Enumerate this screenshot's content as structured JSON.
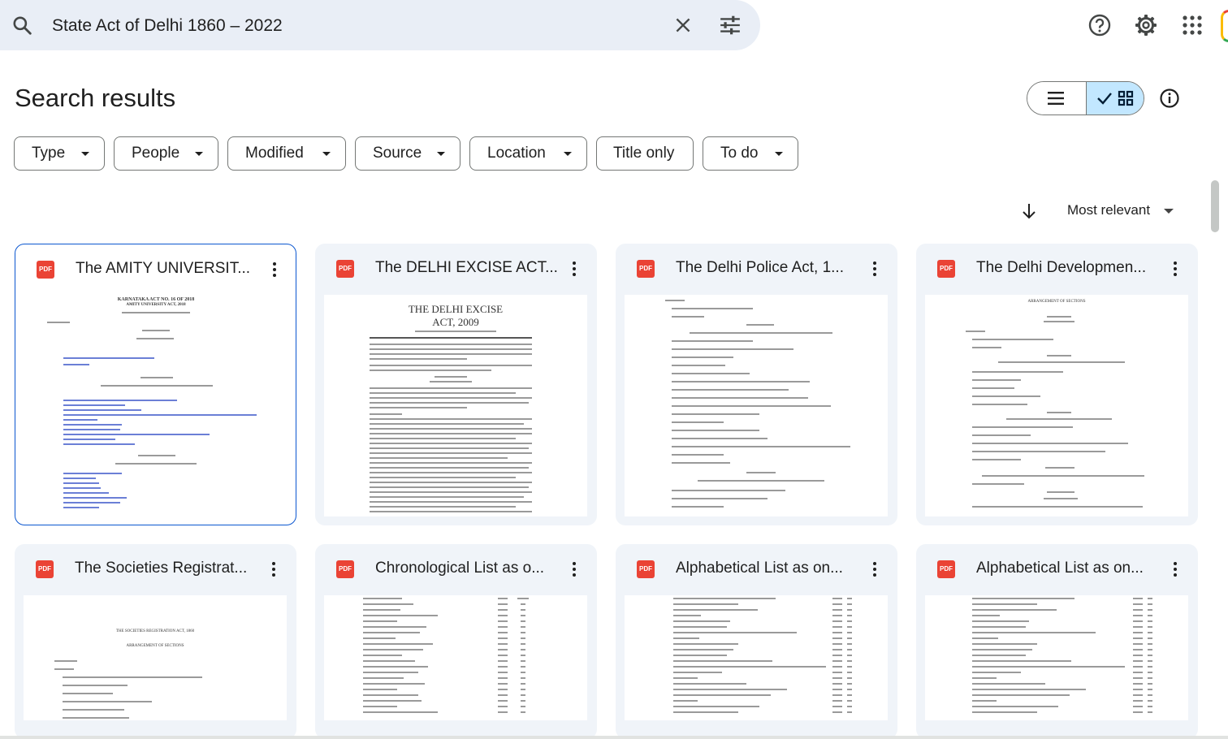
{
  "search": {
    "query": "State Act of Delhi 1860 – 2022"
  },
  "page": {
    "title": "Search results"
  },
  "filters": [
    {
      "label": "Type",
      "dropdown": true
    },
    {
      "label": "People",
      "dropdown": true
    },
    {
      "label": "Modified",
      "dropdown": true
    },
    {
      "label": "Source",
      "dropdown": true
    },
    {
      "label": "Location",
      "dropdown": true
    },
    {
      "label": "Title only",
      "dropdown": false
    },
    {
      "label": "To do",
      "dropdown": true
    }
  ],
  "sort": {
    "label": "Most relevant"
  },
  "view": {
    "selected": "grid"
  },
  "icons": [
    "search-icon",
    "close-icon",
    "tune-icon",
    "help-icon",
    "gear-icon",
    "apps-icon",
    "list-view-icon",
    "grid-view-icon",
    "check-icon",
    "info-icon",
    "arrow-down-icon",
    "more-vert-icon",
    "pdf-icon"
  ],
  "files": [
    {
      "name": "The AMITY UNIVERSIT...",
      "type": "PDF",
      "selected": true,
      "preview_heading": "KARNATAKA ACT NO. 16 OF 2018",
      "preview_subheading": "AMITY UNIVERSITY ACT, 2018"
    },
    {
      "name": "The DELHI EXCISE ACT...",
      "type": "PDF",
      "selected": false,
      "preview_heading": "THE DELHI EXCISE",
      "preview_subheading": "ACT, 2009"
    },
    {
      "name": "The Delhi Police Act, 1...",
      "type": "PDF",
      "selected": false,
      "preview_heading": "",
      "preview_subheading": ""
    },
    {
      "name": "The Delhi Developmen...",
      "type": "PDF",
      "selected": false,
      "preview_heading": "ARRANGEMENT OF SECTIONS",
      "preview_subheading": ""
    },
    {
      "name": "The Societies Registrat...",
      "type": "PDF",
      "selected": false,
      "preview_heading": "THE SOCIETIES REGISTRATION ACT, 1860",
      "preview_subheading": "ARRANGEMENT OF SECTIONS"
    },
    {
      "name": "Chronological List as o...",
      "type": "PDF",
      "selected": false,
      "preview_heading": "",
      "preview_subheading": ""
    },
    {
      "name": "Alphabetical List as on...",
      "type": "PDF",
      "selected": false,
      "preview_heading": "",
      "preview_subheading": ""
    },
    {
      "name": "Alphabetical List as on...",
      "type": "PDF",
      "selected": false,
      "preview_heading": "",
      "preview_subheading": ""
    }
  ],
  "colors": {
    "accent": "#0b57d0",
    "search_bg": "#e9eef6",
    "card_bg": "#f0f4f9",
    "toggle_selected": "#c2e7ff",
    "pdf_red": "#ea4335"
  }
}
